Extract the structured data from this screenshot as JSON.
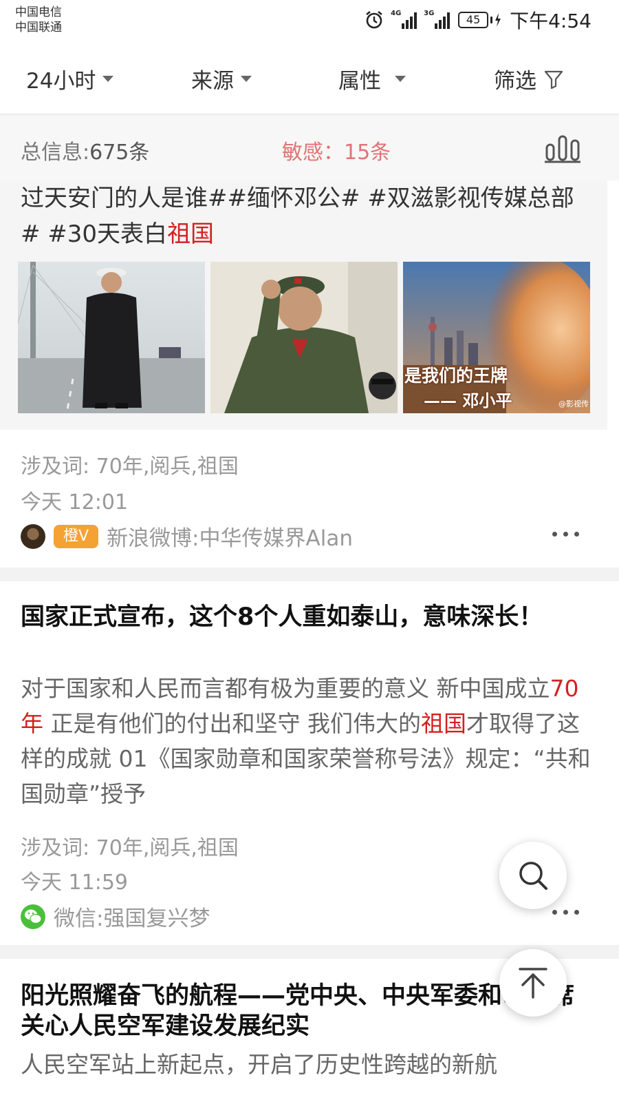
{
  "status_bar": {
    "carrier_1": "中国电信",
    "carrier_2": "中国联通",
    "network_1": "4G",
    "network_2": "3G",
    "battery": "45",
    "time": "下午4:54"
  },
  "filters": [
    {
      "label": "24小时",
      "icon": "caret-down-icon"
    },
    {
      "label": "来源",
      "icon": "caret-down-icon"
    },
    {
      "label": "属性",
      "icon": "caret-down-icon"
    },
    {
      "label": "筛选",
      "icon": "filter-funnel-icon"
    }
  ],
  "summary": {
    "total_label": "总信息:",
    "total_value": "675条",
    "sensitive_label": "敏感：",
    "sensitive_value": "15条",
    "stats_icon": "bar-chart-icon"
  },
  "items": [
    {
      "excerpt_plain": "过天安门的人是谁##缅怀邓公# #双滋影视传媒总部# #30天表白",
      "excerpt_highlight": "祖国",
      "images": [
        {
          "alt": "邓小平在大桥上的照片"
        },
        {
          "alt": "邓小平敬礼的照片"
        },
        {
          "alt": "邓小平与浦东城市风光合成图",
          "overlay_line_1": "是我们的王牌",
          "overlay_line_2": "—— 邓小平",
          "watermark": "@影视传"
        }
      ],
      "keywords": "涉及词: 70年,阅兵,祖国",
      "time": "今天 12:01",
      "badge": "橙V",
      "source": "新浪微博:中华传媒界Alan"
    },
    {
      "title": "国家正式宣布，这个8个人重如泰山，意味深长！",
      "body_1": "对于国家和人民而言都有极为重要的意义 新中国成立",
      "body_hl_1": "70年",
      "body_2": " 正是有他们的付出和坚守 我们伟大的",
      "body_hl_2": "祖国",
      "body_3": "才取得了这样的成就 01《国家勋章和国家荣誉称号法》规定：“共和国勋章”授予",
      "keywords": "涉及词: 70年,阅兵,祖国",
      "time": "今天 11:59",
      "source": "微信:强国复兴梦"
    },
    {
      "title": "阳光照耀奋飞的航程——党中央、中央军委和习主席关心人民空军建设发展纪实",
      "body": "人民空军站上新起点，开启了历史性跨越的新航"
    }
  ],
  "floating": {
    "search_icon": "search-icon",
    "top_icon": "back-to-top-icon"
  }
}
